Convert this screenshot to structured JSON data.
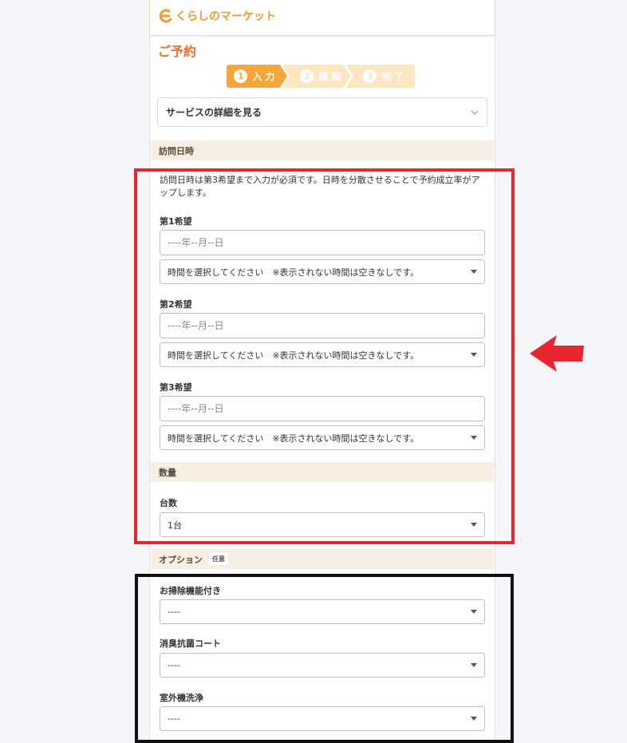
{
  "header": {
    "logo_text": "くらしのマーケット"
  },
  "page": {
    "title": "ご予約"
  },
  "steps": [
    {
      "num": "1",
      "label": "入力",
      "state": "active"
    },
    {
      "num": "2",
      "label": "確認",
      "state": "inactive"
    },
    {
      "num": "3",
      "label": "完了",
      "state": "inactive"
    }
  ],
  "accordion": {
    "title": "サービスの詳細を見る"
  },
  "visit": {
    "section_title": "訪問日時",
    "note": "訪問日時は第3希望まで入力が必須です。日時を分散させることで予約成立率がアップします。",
    "choices": [
      {
        "label": "第1希望",
        "date_placeholder": "----年--月--日",
        "time_value": "時間を選択してください　※表示されない時間は空きなしです。"
      },
      {
        "label": "第2希望",
        "date_placeholder": "----年--月--日",
        "time_value": "時間を選択してください　※表示されない時間は空きなしです。"
      },
      {
        "label": "第3希望",
        "date_placeholder": "----年--月--日",
        "time_value": "時間を選択してください　※表示されない時間は空きなしです。"
      }
    ]
  },
  "quantity": {
    "section_title": "数量",
    "label": "台数",
    "value": "1台"
  },
  "options": {
    "section_title": "オプション",
    "badge": "任意",
    "items": [
      {
        "label": "お掃除機能付き",
        "value": "----"
      },
      {
        "label": "消臭抗菌コート",
        "value": "----"
      },
      {
        "label": "室外機洗浄",
        "value": "----"
      }
    ]
  },
  "colors": {
    "accent": "#f7a63a",
    "title": "#ee6f2d",
    "band": "#f7efe3",
    "annotation_red": "#e8242f",
    "annotation_black": "#111111"
  }
}
